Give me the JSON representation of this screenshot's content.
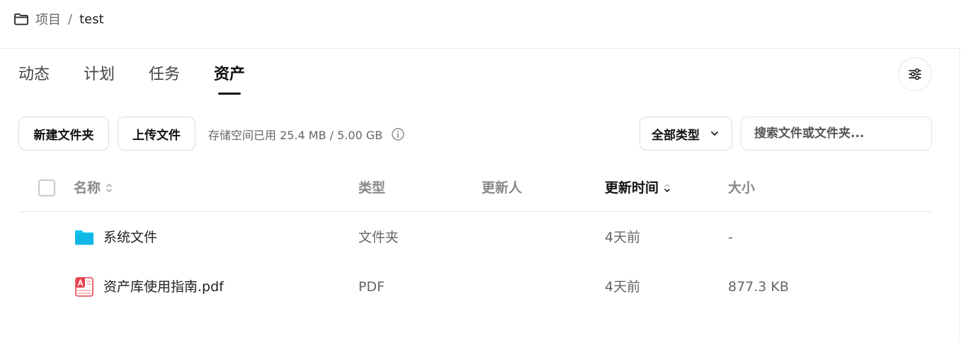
{
  "breadcrumb": {
    "root": "项目",
    "separator": "/",
    "current": "test"
  },
  "tabs": [
    {
      "label": "动态",
      "active": false
    },
    {
      "label": "计划",
      "active": false
    },
    {
      "label": "任务",
      "active": false
    },
    {
      "label": "资产",
      "active": true
    }
  ],
  "toolbar": {
    "new_folder_label": "新建文件夹",
    "upload_label": "上传文件",
    "storage_text": "存储空间已用 25.4 MB / 5.00 GB",
    "type_filter_value": "全部类型",
    "search_placeholder": "搜索文件或文件夹..."
  },
  "table": {
    "headers": {
      "name": "名称",
      "type": "类型",
      "updater": "更新人",
      "updated_time": "更新时间",
      "size": "大小"
    },
    "rows": [
      {
        "name": "系统文件",
        "type": "文件夹",
        "updater": "",
        "updated_time": "4天前",
        "size": "-",
        "icon": "folder-icon"
      },
      {
        "name": "资产库使用指南.pdf",
        "type": "PDF",
        "updater": "",
        "updated_time": "4天前",
        "size": "877.3 KB",
        "icon": "pdf-file-icon"
      }
    ]
  },
  "colors": {
    "accent_text": "#111111",
    "muted_text": "#666666",
    "folder_blue": "#10c4f5",
    "pdf_red": "#e8414d"
  }
}
